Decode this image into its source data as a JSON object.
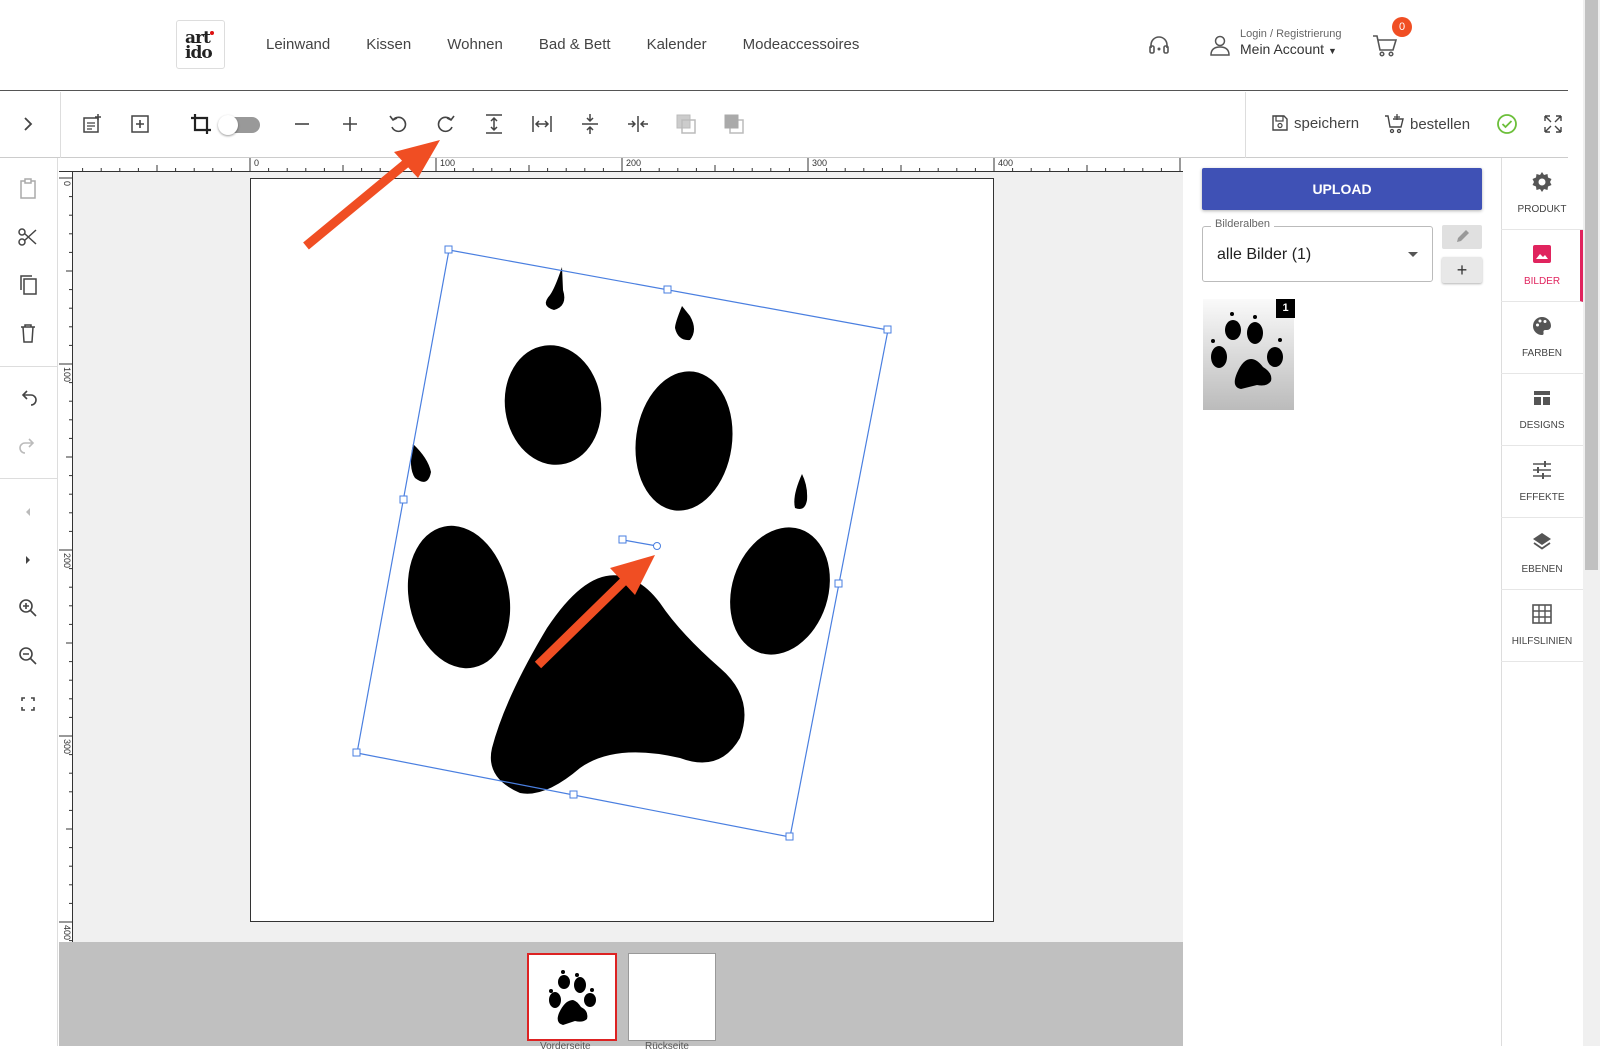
{
  "header": {
    "logo": {
      "line1": "art",
      "line2": "ido"
    },
    "nav": [
      "Leinwand",
      "Kissen",
      "Wohnen",
      "Bad & Bett",
      "Kalender",
      "Modeaccessoires"
    ],
    "login_small": "Login / Registrierung",
    "login_main": "Mein Account",
    "cart_count": "0"
  },
  "toolbar": {
    "save_label": "speichern",
    "order_label": "bestellen"
  },
  "rulers": {
    "top": [
      "0",
      "100",
      "200",
      "300",
      "400"
    ],
    "left": [
      "0",
      "100",
      "200",
      "300",
      "400"
    ]
  },
  "right_panel": {
    "upload_label": "UPLOAD",
    "album_legend": "Bilderalben",
    "album_value": "alle Bilder (1)",
    "add_label": "+",
    "thumb_badge": "1"
  },
  "right_nav": [
    {
      "label": "PRODUKT",
      "icon": "gear-icon"
    },
    {
      "label": "BILDER",
      "icon": "image-icon",
      "active": true
    },
    {
      "label": "FARBEN",
      "icon": "palette-icon"
    },
    {
      "label": "DESIGNS",
      "icon": "designs-icon"
    },
    {
      "label": "EFFEKTE",
      "icon": "sliders-icon"
    },
    {
      "label": "EBENEN",
      "icon": "layers-icon"
    },
    {
      "label": "HILFSLINIEN",
      "icon": "grid-icon"
    }
  ],
  "pages": [
    {
      "label": "Vorderseite"
    },
    {
      "label": "Rückseite"
    }
  ],
  "colors": {
    "accent_blue": "#3f51b5",
    "accent_pink": "#e0245e",
    "arrow": "#f04e23",
    "selection": "#4a7fe0"
  }
}
